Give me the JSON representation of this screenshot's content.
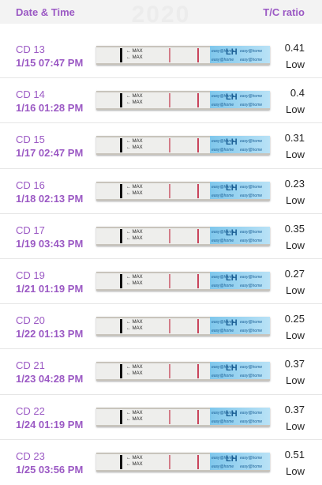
{
  "header": {
    "date_time_label": "Date & Time",
    "ratio_label": "T/C ratio",
    "ghost_text": "2020"
  },
  "strip_text": {
    "max": "← MAX",
    "lh": "LH",
    "brand": "easy@home"
  },
  "colors": {
    "accent": "#9b59c4",
    "strip_blue": "#8ccdf0",
    "test_line": "#d37c88"
  },
  "rows": [
    {
      "cd": "CD 13",
      "datetime": "1/15  07:47 PM",
      "ratio": "0.41",
      "level": "Low"
    },
    {
      "cd": "CD 14",
      "datetime": "1/16  01:28 PM",
      "ratio": "0.4",
      "level": "Low"
    },
    {
      "cd": "CD 15",
      "datetime": "1/17  02:47 PM",
      "ratio": "0.31",
      "level": "Low"
    },
    {
      "cd": "CD 16",
      "datetime": "1/18  02:13 PM",
      "ratio": "0.23",
      "level": "Low"
    },
    {
      "cd": "CD 17",
      "datetime": "1/19  03:43 PM",
      "ratio": "0.35",
      "level": "Low"
    },
    {
      "cd": "CD 19",
      "datetime": "1/21  01:19 PM",
      "ratio": "0.27",
      "level": "Low"
    },
    {
      "cd": "CD 20",
      "datetime": "1/22  01:13 PM",
      "ratio": "0.25",
      "level": "Low"
    },
    {
      "cd": "CD 21",
      "datetime": "1/23  04:28 PM",
      "ratio": "0.37",
      "level": "Low"
    },
    {
      "cd": "CD 22",
      "datetime": "1/24  01:19 PM",
      "ratio": "0.37",
      "level": "Low"
    },
    {
      "cd": "CD 23",
      "datetime": "1/25  03:56 PM",
      "ratio": "0.51",
      "level": "Low"
    }
  ]
}
